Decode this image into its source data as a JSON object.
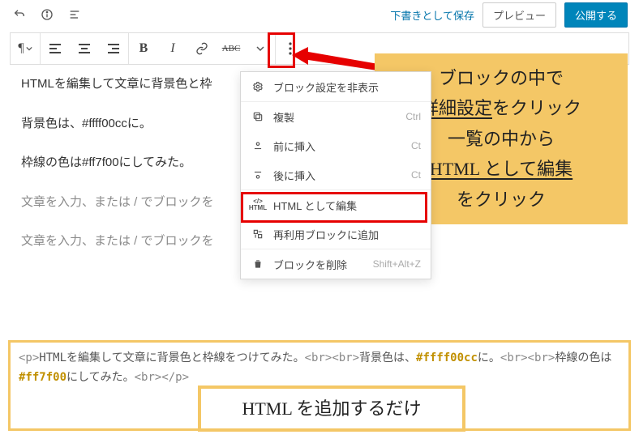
{
  "topbar": {
    "save_draft": "下書きとして保存",
    "preview": "プレビュー",
    "publish": "公開する"
  },
  "toolbar": {
    "pilcrow": "¶",
    "align_left": "align-left",
    "align_center": "align-center",
    "align_right": "align-right",
    "bold": "B",
    "italic": "I",
    "link": "link",
    "strike": "ABC",
    "more": "more"
  },
  "editor": {
    "line1": "HTMLを編集して文章に背景色と枠",
    "line2": "背景色は、#ffff00ccに。",
    "line3": "枠線の色は#ff7f00にしてみた。",
    "ph1": "文章を入力、または / でブロックを",
    "ph2": "文章を入力、または / でブロックを"
  },
  "dropdown": {
    "block_settings": "ブロック設定を非表示",
    "duplicate": "複製",
    "duplicate_sc": "Ctrl",
    "insert_before": "前に挿入",
    "insert_before_sc": "Ct",
    "insert_after": "後に挿入",
    "insert_after_sc": "Ct",
    "edit_html": "HTML として編集",
    "add_reusable": "再利用ブロックに追加",
    "remove": "ブロックを削除",
    "remove_sc": "Shift+Alt+Z"
  },
  "callout1": {
    "l1": "ブロックの中で",
    "l2a": "詳細設定",
    "l2b": "をクリック",
    "l3": "一覧の中から",
    "l4a": "HTML として編集",
    "l5": "をクリック"
  },
  "callout2": {
    "text": "HTML を追加するだけ"
  },
  "code": {
    "t_open_p": "<p>",
    "s1": "HTMLを編集して文章に背景色と枠線をつけてみた。",
    "t_br": "<br>",
    "s2": "背景色は、",
    "hl1": "#ffff00cc",
    "s3": "に。",
    "s4": "枠線の色は",
    "hl2": "#ff7f00",
    "s5": "にしてみた。",
    "t_close_p": "</p>"
  }
}
